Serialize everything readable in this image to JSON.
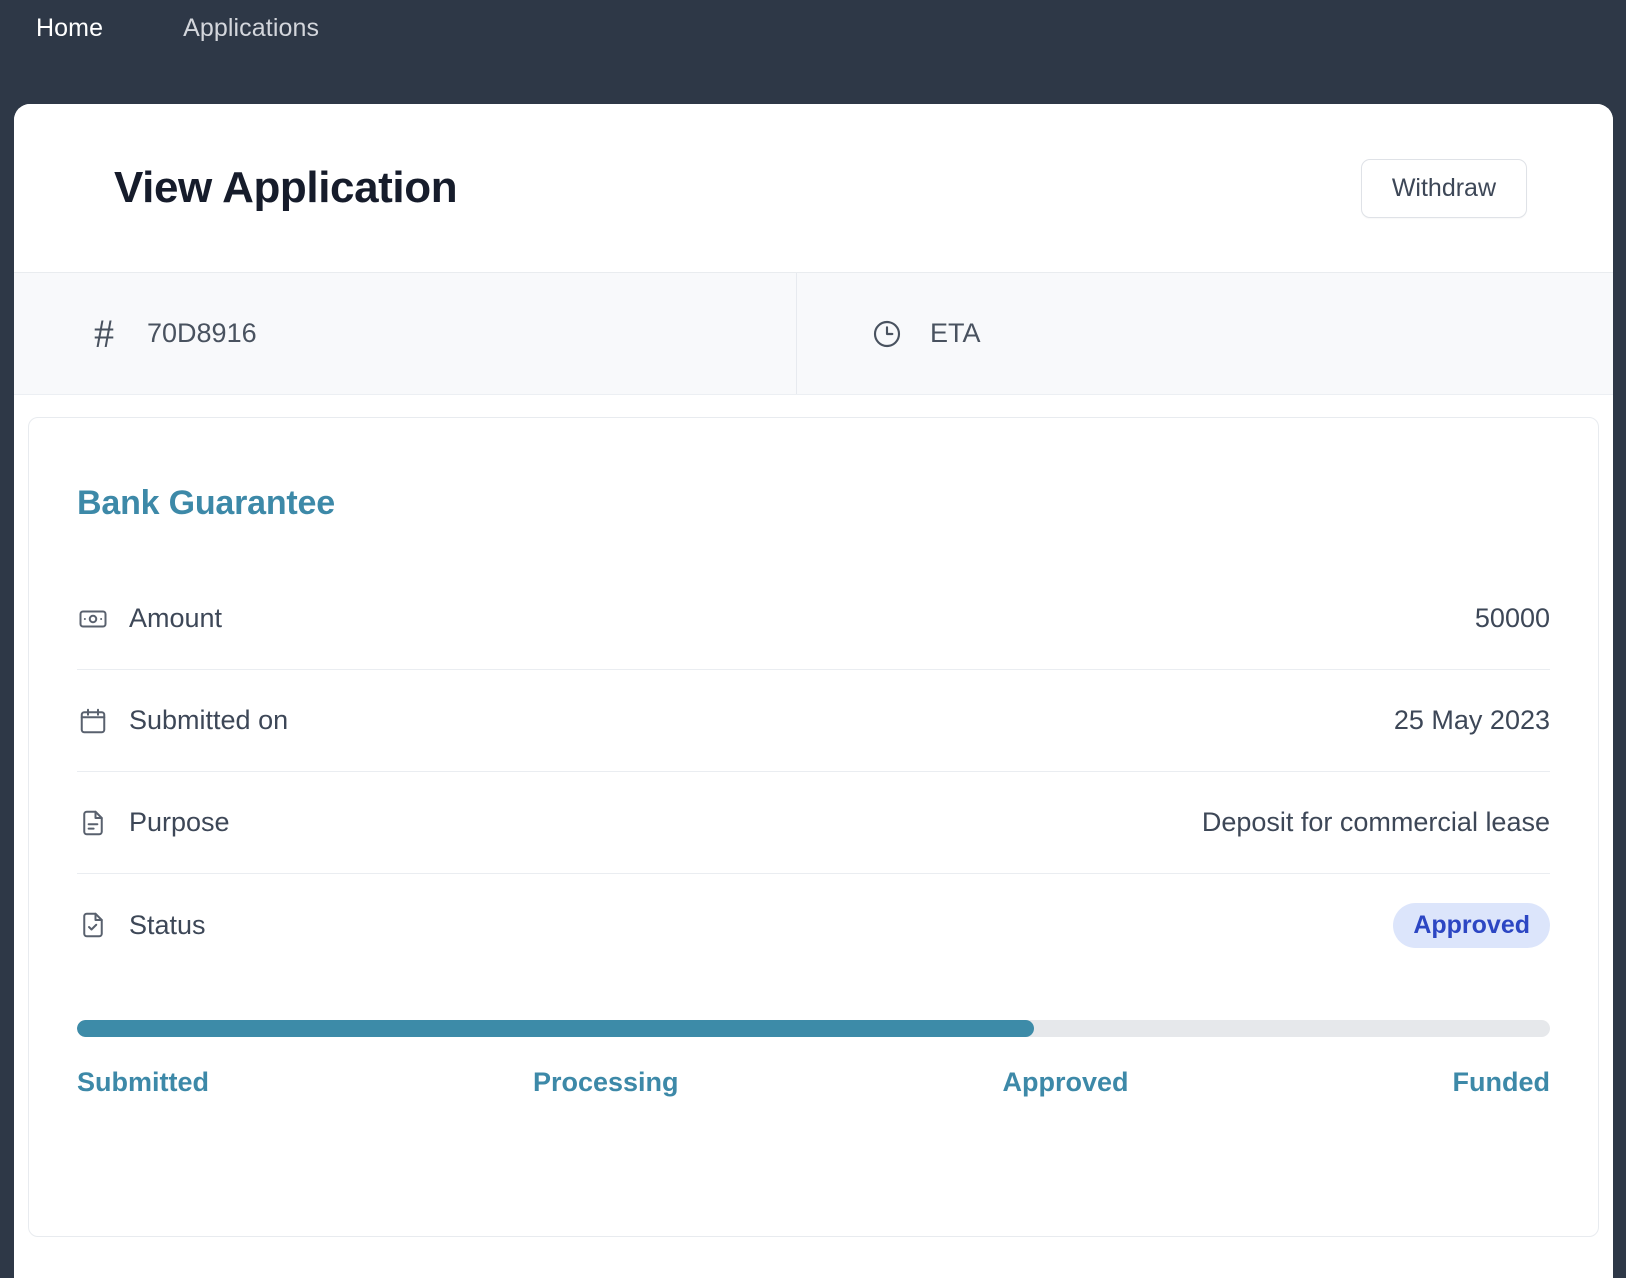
{
  "nav": {
    "items": [
      {
        "label": "Home",
        "active": true
      },
      {
        "label": "Applications",
        "active": false
      }
    ]
  },
  "header": {
    "title": "View Application",
    "withdraw_label": "Withdraw"
  },
  "meta": {
    "reference": {
      "icon": "hash-icon",
      "value": "70D8916"
    },
    "eta": {
      "icon": "clock-icon",
      "label": "ETA",
      "value": ""
    }
  },
  "detail": {
    "heading": "Bank Guarantee",
    "rows": [
      {
        "icon": "banknote-icon",
        "label": "Amount",
        "value": "50000",
        "type": "text"
      },
      {
        "icon": "calendar-icon",
        "label": "Submitted on",
        "value": "25 May 2023",
        "type": "text"
      },
      {
        "icon": "document-text-icon",
        "label": "Purpose",
        "value": "Deposit for commercial lease",
        "type": "text"
      },
      {
        "icon": "document-check-icon",
        "label": "Status",
        "value": "Approved",
        "type": "badge"
      }
    ],
    "progress": {
      "percent": 65,
      "fill_color": "#3d8ba8",
      "track_color": "#e6e8eb",
      "steps": [
        "Submitted",
        "Processing",
        "Approved",
        "Funded"
      ]
    }
  },
  "colors": {
    "nav_background": "#2e3847",
    "accent_teal": "#3d89a8",
    "badge_background": "#dce5fb",
    "badge_text": "#2c46c3",
    "title_text": "#161c2b"
  }
}
